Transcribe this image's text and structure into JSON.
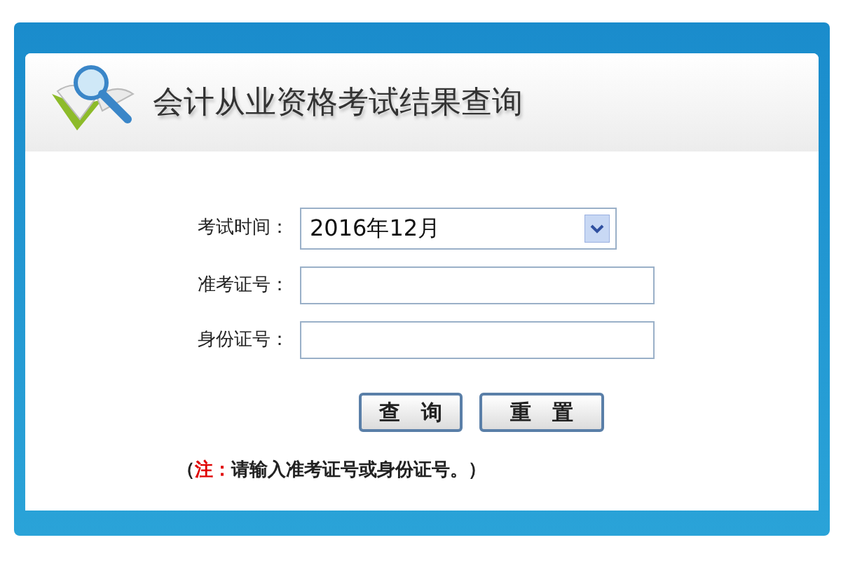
{
  "title": "会计从业资格考试结果查询",
  "fields": [
    {
      "kind": "select",
      "label": "考试时间：",
      "value": "2016年12月"
    },
    {
      "kind": "text",
      "label": "准考证号："
    },
    {
      "kind": "text",
      "label": "身份证号："
    }
  ],
  "buttons": [
    "查 询",
    "重 置"
  ],
  "note": {
    "open": "（",
    "highlight": "注：",
    "text": "请输入准考证号或身份证号。）"
  }
}
